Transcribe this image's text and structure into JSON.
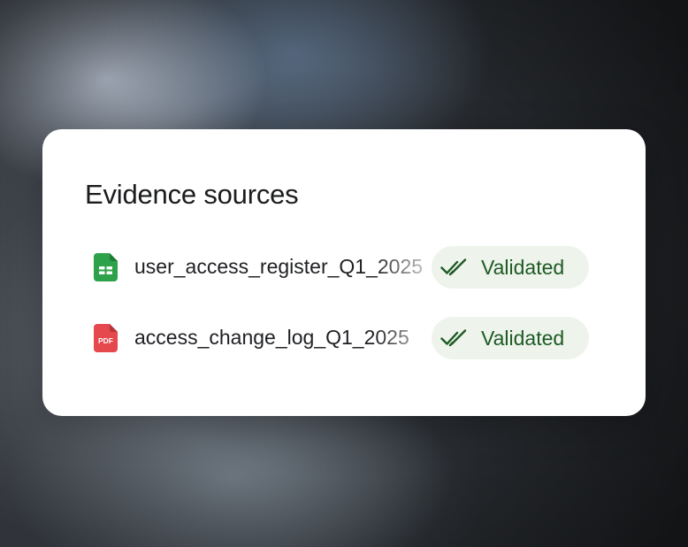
{
  "card": {
    "title": "Evidence sources"
  },
  "sources": [
    {
      "file_name": "user_access_register_Q1_2025",
      "file_type_icon": "spreadsheet-icon",
      "status": "Validated",
      "status_icon": "double-check-icon"
    },
    {
      "file_name": "access_change_log_Q1_2025",
      "file_type_icon": "pdf-icon",
      "file_type_label": "PDF",
      "status": "Validated",
      "status_icon": "double-check-icon"
    }
  ],
  "colors": {
    "card_background": "#ffffff",
    "badge_background": "#eef4ec",
    "badge_text": "#1e5a24",
    "spreadsheet_icon": "#2ea24a",
    "pdf_icon": "#e5484d"
  }
}
